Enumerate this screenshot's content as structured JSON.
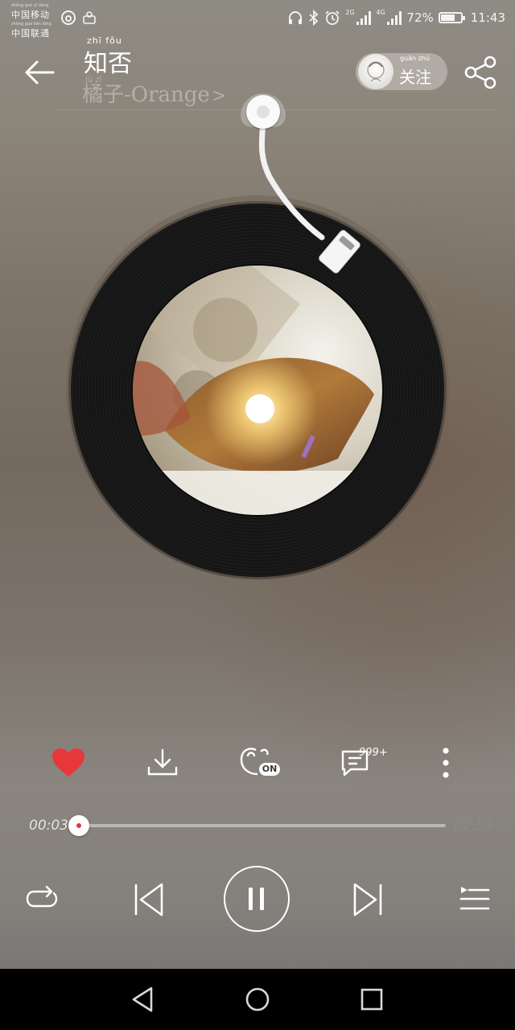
{
  "status_bar": {
    "carrier_line1": "中国移动",
    "carrier_line1_pinyin": "zhōng guó yí dòng",
    "carrier_line2": "中国联通",
    "carrier_line2_pinyin": "zhōng guó lián tōng",
    "net_type_1": "2G",
    "net_type_2": "4G",
    "battery_percent": "72%",
    "battery_level": 0.72,
    "time": "11:43",
    "icons": [
      "netease-icon",
      "notification-icon",
      "headphones-icon",
      "bluetooth-icon",
      "alarm-icon",
      "signal-icon",
      "signal-icon",
      "battery-icon"
    ]
  },
  "header": {
    "title": "知否",
    "title_pinyin": "zhī fǒu",
    "artist": "橘子-Orange",
    "artist_pinyin": "jú zǐ",
    "artist_chevron": ">",
    "follow_label": "关注",
    "follow_pinyin": "guān zhù"
  },
  "actions": {
    "like_liked": true,
    "effect_badge": "ON",
    "comment_count": "999+"
  },
  "progress": {
    "elapsed": "00:03",
    "total": "02:53",
    "fraction": 0.017
  },
  "controls": {
    "state": "playing",
    "mode": "repeat"
  },
  "colors": {
    "accent": "#e23a3a",
    "nav_bar": "#000000"
  }
}
